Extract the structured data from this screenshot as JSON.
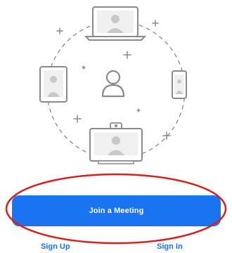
{
  "main": {
    "join_label": "Join a Meeting",
    "signup_label": "Sign Up",
    "signin_label": "Sign In"
  },
  "colors": {
    "accent": "#1a73f0",
    "highlight": "#d61f1f",
    "device_stroke": "#8a8a8a",
    "device_fill": "#f2f2f2"
  },
  "icons": [
    "laptop-icon",
    "tablet-icon",
    "phone-icon",
    "room-system-icon",
    "user-avatar-icon",
    "plus-sparkle-icon"
  ]
}
